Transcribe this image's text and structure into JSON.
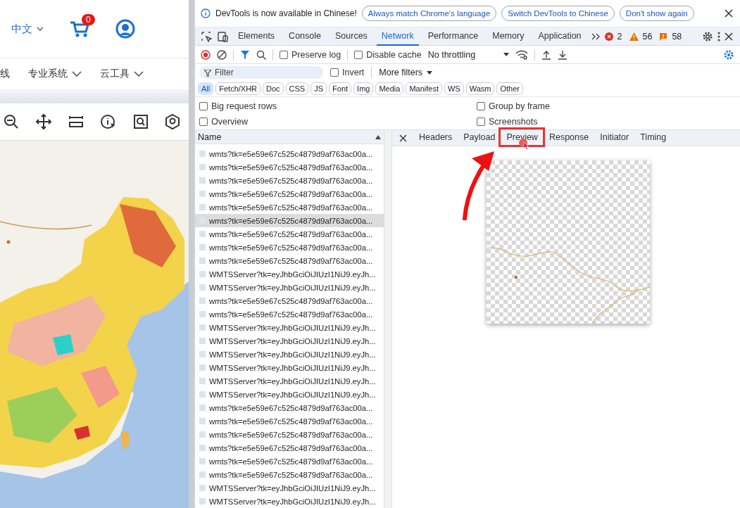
{
  "site": {
    "language": "中文",
    "cart_count": "0",
    "nav": [
      {
        "label": "线",
        "dropdown": false
      },
      {
        "label": "专业系统",
        "dropdown": true
      },
      {
        "label": "云工具",
        "dropdown": true
      }
    ]
  },
  "devtools": {
    "infobar": {
      "message": "DevTools is now available in Chinese!",
      "buttons": [
        "Always match Chrome's language",
        "Switch DevTools to Chinese",
        "Don't show again"
      ]
    },
    "tabs": [
      {
        "label": "Elements",
        "selected": false
      },
      {
        "label": "Console",
        "selected": false
      },
      {
        "label": "Sources",
        "selected": false
      },
      {
        "label": "Network",
        "selected": true
      },
      {
        "label": "Performance",
        "selected": false
      },
      {
        "label": "Memory",
        "selected": false
      },
      {
        "label": "Application",
        "selected": false
      }
    ],
    "counts": {
      "errors": "2",
      "warnings": "56",
      "issues": "58"
    },
    "toolbar": {
      "preserve_log": {
        "label": "Preserve log",
        "checked": false
      },
      "disable_cache": {
        "label": "Disable cache",
        "checked": false
      },
      "throttling": "No throttling"
    },
    "filter": {
      "placeholder": "Filter",
      "invert": {
        "label": "Invert",
        "checked": false
      },
      "more_filters": "More filters"
    },
    "types": [
      {
        "label": "All",
        "selected": true
      },
      {
        "label": "Fetch/XHR",
        "selected": false
      },
      {
        "label": "Doc",
        "selected": false
      },
      {
        "label": "CSS",
        "selected": false
      },
      {
        "label": "JS",
        "selected": false
      },
      {
        "label": "Font",
        "selected": false
      },
      {
        "label": "Img",
        "selected": false
      },
      {
        "label": "Media",
        "selected": false
      },
      {
        "label": "Manifest",
        "selected": false
      },
      {
        "label": "WS",
        "selected": false
      },
      {
        "label": "Wasm",
        "selected": false
      },
      {
        "label": "Other",
        "selected": false
      }
    ],
    "options": [
      {
        "label": "Big request rows",
        "checked": false
      },
      {
        "label": "Group by frame",
        "checked": false
      },
      {
        "label": "Overview",
        "checked": false
      },
      {
        "label": "Screenshots",
        "checked": false
      }
    ],
    "list_header": "Name",
    "requests": [
      {
        "name": "wmts?tk=e5e59e67c525c4879d9af763ac00a...",
        "selected": false
      },
      {
        "name": "wmts?tk=e5e59e67c525c4879d9af763ac00a...",
        "selected": false
      },
      {
        "name": "wmts?tk=e5e59e67c525c4879d9af763ac00a...",
        "selected": false
      },
      {
        "name": "wmts?tk=e5e59e67c525c4879d9af763ac00a...",
        "selected": false
      },
      {
        "name": "wmts?tk=e5e59e67c525c4879d9af763ac00a...",
        "selected": false
      },
      {
        "name": "wmts?tk=e5e59e67c525c4879d9af763ac00a...",
        "selected": true
      },
      {
        "name": "wmts?tk=e5e59e67c525c4879d9af763ac00a...",
        "selected": false
      },
      {
        "name": "wmts?tk=e5e59e67c525c4879d9af763ac00a...",
        "selected": false
      },
      {
        "name": "wmts?tk=e5e59e67c525c4879d9af763ac00a...",
        "selected": false
      },
      {
        "name": "WMTSServer?tk=eyJhbGciOiJIUzI1NiJ9.eyJh...",
        "selected": false
      },
      {
        "name": "WMTSServer?tk=eyJhbGciOiJIUzI1NiJ9.eyJh...",
        "selected": false
      },
      {
        "name": "wmts?tk=e5e59e67c525c4879d9af763ac00a...",
        "selected": false
      },
      {
        "name": "wmts?tk=e5e59e67c525c4879d9af763ac00a...",
        "selected": false
      },
      {
        "name": "WMTSServer?tk=eyJhbGciOiJIUzI1NiJ9.eyJh...",
        "selected": false
      },
      {
        "name": "WMTSServer?tk=eyJhbGciOiJIUzI1NiJ9.eyJh...",
        "selected": false
      },
      {
        "name": "WMTSServer?tk=eyJhbGciOiJIUzI1NiJ9.eyJh...",
        "selected": false
      },
      {
        "name": "WMTSServer?tk=eyJhbGciOiJIUzI1NiJ9.eyJh...",
        "selected": false
      },
      {
        "name": "WMTSServer?tk=eyJhbGciOiJIUzI1NiJ9.eyJh...",
        "selected": false
      },
      {
        "name": "WMTSServer?tk=eyJhbGciOiJIUzI1NiJ9.eyJh...",
        "selected": false
      },
      {
        "name": "wmts?tk=e5e59e67c525c4879d9af763ac00a...",
        "selected": false
      },
      {
        "name": "wmts?tk=e5e59e67c525c4879d9af763ac00a...",
        "selected": false
      },
      {
        "name": "wmts?tk=e5e59e67c525c4879d9af763ac00a...",
        "selected": false
      },
      {
        "name": "wmts?tk=e5e59e67c525c4879d9af763ac00a...",
        "selected": false
      },
      {
        "name": "wmts?tk=e5e59e67c525c4879d9af763ac00a...",
        "selected": false
      },
      {
        "name": "wmts?tk=e5e59e67c525c4879d9af763ac00a...",
        "selected": false
      },
      {
        "name": "WMTSServer?tk=eyJhbGciOiJIUzI1NiJ9.eyJh...",
        "selected": false
      },
      {
        "name": "WMTSServer?tk=eyJhbGciOiJIUzI1NiJ9.eyJh...",
        "selected": false
      }
    ],
    "detail_tabs": [
      {
        "label": "Headers",
        "selected": false
      },
      {
        "label": "Payload",
        "selected": false
      },
      {
        "label": "Preview",
        "selected": true
      },
      {
        "label": "Response",
        "selected": false
      },
      {
        "label": "Initiator",
        "selected": false
      },
      {
        "label": "Timing",
        "selected": false
      }
    ]
  }
}
